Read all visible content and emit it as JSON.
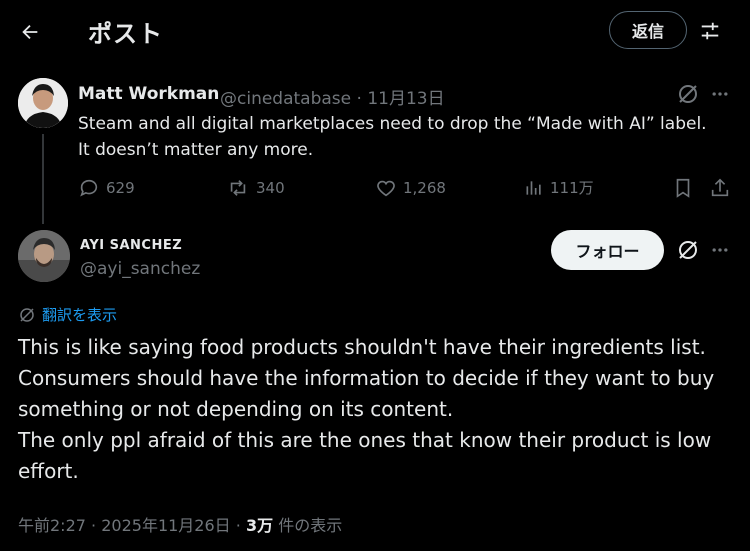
{
  "header": {
    "title": "ポスト",
    "reply_label": "返信"
  },
  "parent_tweet": {
    "author_name": "Matt Workman",
    "handle": "@cinedatabase",
    "separator": "·",
    "date": "11月13日",
    "text": "Steam and all digital marketplaces need to drop the “Made with AI” label.  It doesn’t matter any more.",
    "stats": {
      "replies": "629",
      "reposts": "340",
      "likes": "1,268",
      "views": "111万"
    }
  },
  "reply_tweet": {
    "author_name": "AYI SANCHEZ",
    "handle": "@ayi_sanchez",
    "follow_label": "フォロー",
    "translate_label": "翻訳を表示",
    "text": "This is like saying food products shouldn't have their ingredients list.\nConsumers should have the information to decide if they want to buy something or not depending on its content.\nThe only ppl afraid of this are the ones that know their product is low effort.",
    "time": "午前2:27",
    "separator": "·",
    "date": "2025年11月26日",
    "view_count": "3万",
    "view_label": "件の表示"
  },
  "colors": {
    "background": "#000000",
    "primary_text": "#e7e9ea",
    "secondary_text": "#71767b",
    "link": "#1d9bf0",
    "follow_button_bg": "#eff3f4"
  },
  "icons": [
    "back-arrow-icon",
    "sliders-icon",
    "grok-icon",
    "more-icon",
    "reply-icon",
    "repost-icon",
    "like-icon",
    "views-icon",
    "bookmark-icon",
    "share-icon",
    "translate-globe-icon"
  ]
}
